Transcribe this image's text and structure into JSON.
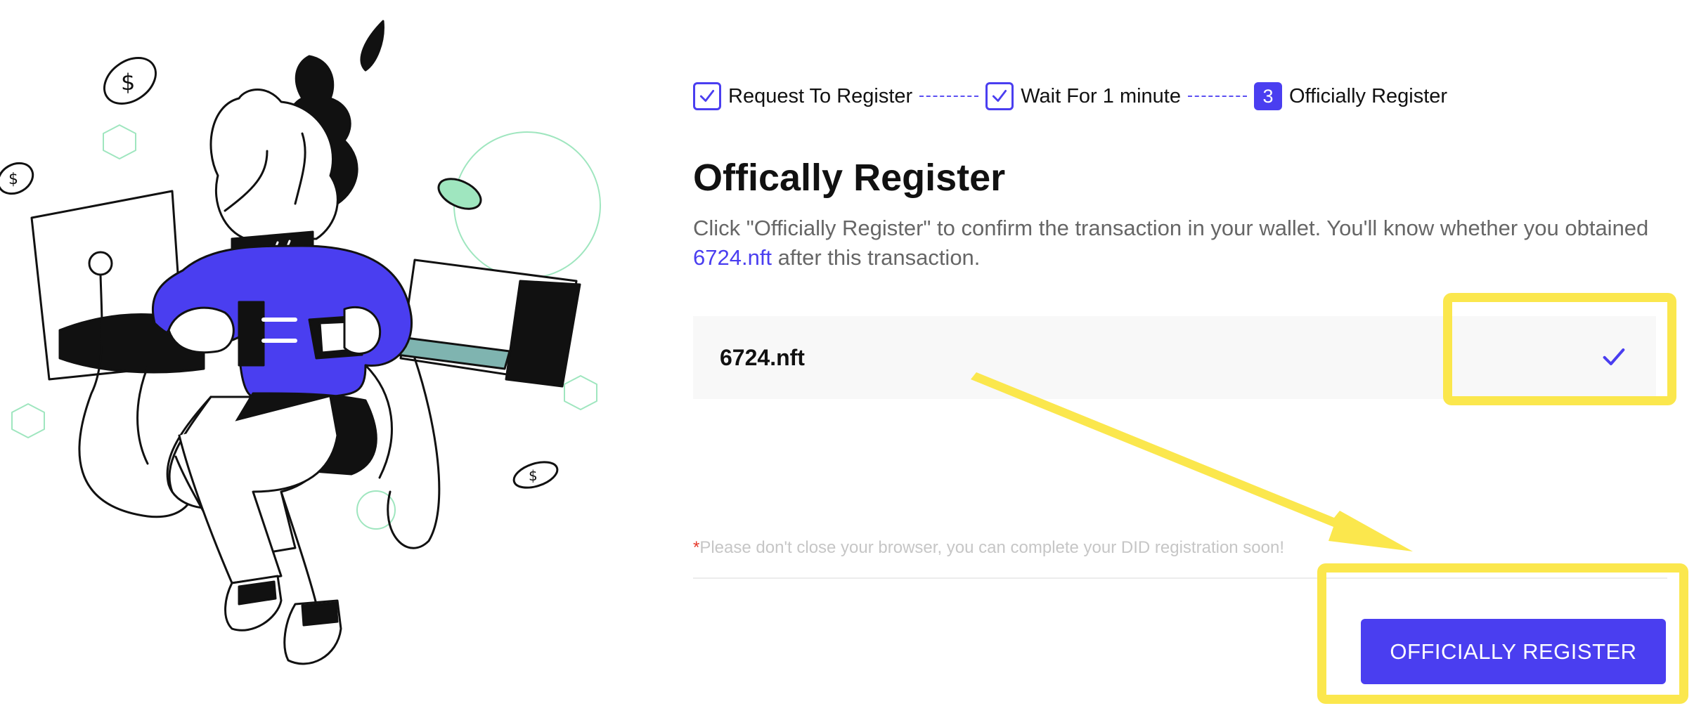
{
  "steps": [
    {
      "label": "Request To Register",
      "status": "done"
    },
    {
      "label": "Wait For 1 minute",
      "status": "done"
    },
    {
      "label": "Officially Register",
      "status": "current",
      "number": "3"
    }
  ],
  "main": {
    "title": "Offically Register",
    "description_prefix": "Click \"Officially Register\" to confirm the transaction in your wallet. You'll know whether you obtained ",
    "description_domain": "6724.nft",
    "description_suffix": " after this transaction.",
    "selected_name": "6724.nft",
    "note_star": "*",
    "note": "Please don't close your browser, you can complete your DID registration soon!",
    "submit_label": "OFFICIALLY REGISTER"
  },
  "colors": {
    "accent": "#4a3ef0",
    "highlight_annotation": "#fbe74d",
    "illustration_green": "#7ee2a8"
  },
  "icons": {
    "step_done": "checkmark-icon",
    "selected": "checkmark-icon",
    "illustration": "character-with-plug-illustration"
  }
}
